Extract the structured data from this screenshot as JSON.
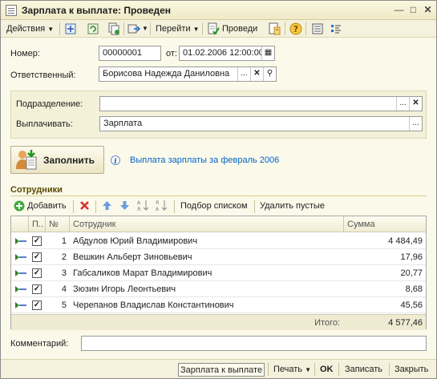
{
  "window": {
    "title": "Зарплата к выплате: Проведен"
  },
  "toolbar": {
    "actions": "Действия",
    "goto": "Перейти",
    "post": "Проведи"
  },
  "header": {
    "number_label": "Номер:",
    "number_value": "00000001",
    "from_label": "от:",
    "date_value": "01.02.2006 12:00:00",
    "responsible_label": "Ответственный:",
    "responsible_value": "Борисова Надежда Даниловна"
  },
  "panel": {
    "division_label": "Подразделение:",
    "division_value": "",
    "pay_label": "Выплачивать:",
    "pay_value": "Зарплата"
  },
  "fill_button": "Заполнить",
  "info_link": "Выплата зарплаты за февраль 2006",
  "employees": {
    "section_title": "Сотрудники",
    "add_label": "Добавить",
    "select_list_label": "Подбор списком",
    "delete_empty_label": "Удалить пустые",
    "columns": {
      "flag": "П..",
      "num": "№",
      "employee": "Сотрудник",
      "sum": "Сумма"
    },
    "rows": [
      {
        "num": "1",
        "name": "Абдулов Юрий Владимирович",
        "sum": "4 484,49"
      },
      {
        "num": "2",
        "name": "Вешкин Альберт Зиновьевич",
        "sum": "17,96"
      },
      {
        "num": "3",
        "name": "Габсаликов Марат Владимирович",
        "sum": "20,77"
      },
      {
        "num": "4",
        "name": "Зюзин Игорь Леонтьевич",
        "sum": "8,68"
      },
      {
        "num": "5",
        "name": "Черепанов Владислав Константинович",
        "sum": "45,56"
      }
    ],
    "total_label": "Итого:",
    "total_value": "4 577,46"
  },
  "comment": {
    "label": "Комментарий:",
    "value": ""
  },
  "bottom": {
    "print_form": "Зарплата к выплате",
    "print": "Печать",
    "ok": "OK",
    "save": "Записать",
    "close": "Закрыть"
  },
  "colors": {
    "background": "#fbf9ea",
    "accent": "#0064c8",
    "section": "#5a4a00"
  }
}
